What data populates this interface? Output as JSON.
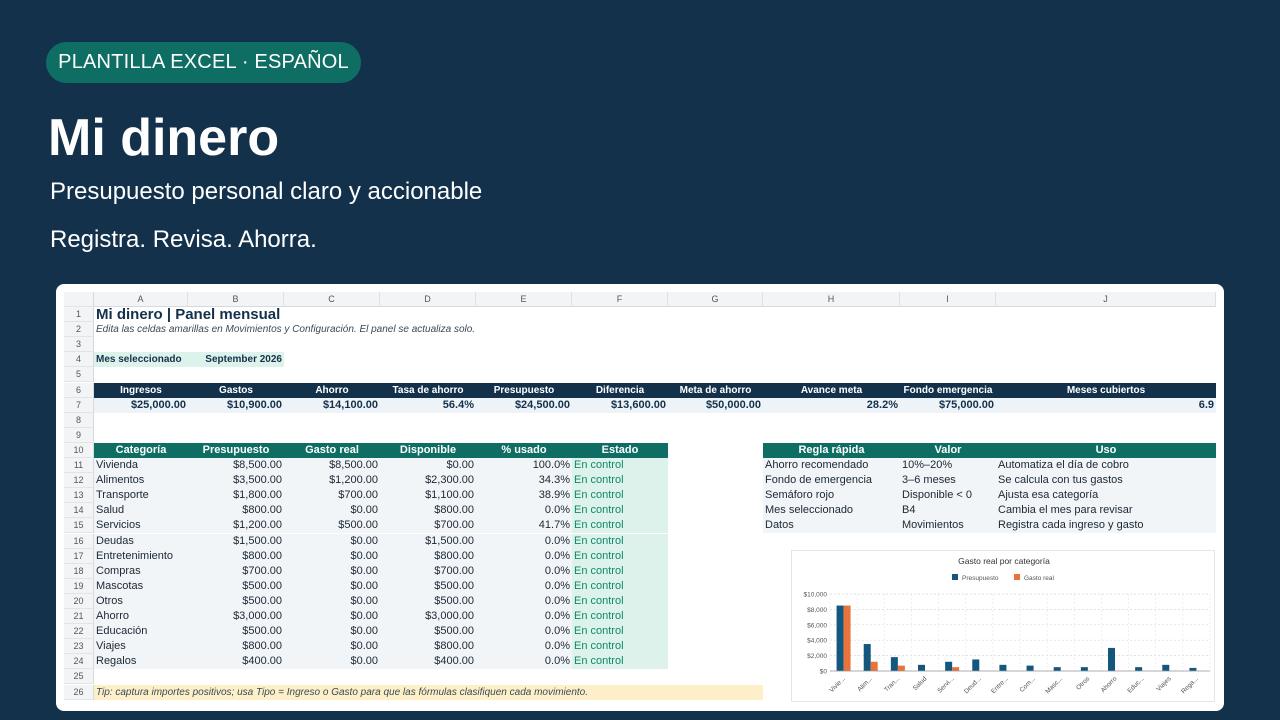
{
  "badge": "PLANTILLA EXCEL · ESPAÑOL",
  "title": "Mi dinero",
  "subtitle": "Presupuesto personal claro y accionable",
  "tagline": "Registra. Revisa. Ahorra.",
  "sheet": {
    "columns": [
      "A",
      "B",
      "C",
      "D",
      "E",
      "F",
      "G",
      "H",
      "I",
      "J"
    ],
    "rows": [
      "1",
      "2",
      "3",
      "4",
      "5",
      "6",
      "7",
      "8",
      "9",
      "10",
      "11",
      "12",
      "13",
      "14",
      "15",
      "16",
      "17",
      "18",
      "19",
      "20",
      "21",
      "22",
      "23",
      "24",
      "25",
      "26"
    ],
    "panel_title": "Mi dinero | Panel mensual",
    "panel_note": "Edita las celdas amarillas en Movimientos y Configuración. El panel se actualiza solo.",
    "month_label": "Mes seleccionado",
    "month_value": "September 2026",
    "kpi_headers": [
      "Ingresos",
      "Gastos",
      "Ahorro",
      "Tasa de ahorro",
      "Presupuesto",
      "Diferencia",
      "Meta de ahorro",
      "Avance meta",
      "Fondo emergencia",
      "Meses cubiertos"
    ],
    "kpi_values": [
      "$25,000.00",
      "$10,900.00",
      "$14,100.00",
      "56.4%",
      "$24,500.00",
      "$13,600.00",
      "$50,000.00",
      "28.2%",
      "$75,000.00",
      "6.9"
    ],
    "table_headers": [
      "Categoría",
      "Presupuesto",
      "Gasto real",
      "Disponible",
      "% usado",
      "Estado"
    ],
    "table_rows": [
      [
        "Vivienda",
        "$8,500.00",
        "$8,500.00",
        "$0.00",
        "100.0%",
        "En control"
      ],
      [
        "Alimentos",
        "$3,500.00",
        "$1,200.00",
        "$2,300.00",
        "34.3%",
        "En control"
      ],
      [
        "Transporte",
        "$1,800.00",
        "$700.00",
        "$1,100.00",
        "38.9%",
        "En control"
      ],
      [
        "Salud",
        "$800.00",
        "$0.00",
        "$800.00",
        "0.0%",
        "En control"
      ],
      [
        "Servicios",
        "$1,200.00",
        "$500.00",
        "$700.00",
        "41.7%",
        "En control"
      ],
      [
        "Deudas",
        "$1,500.00",
        "$0.00",
        "$1,500.00",
        "0.0%",
        "En control"
      ],
      [
        "Entretenimiento",
        "$800.00",
        "$0.00",
        "$800.00",
        "0.0%",
        "En control"
      ],
      [
        "Compras",
        "$700.00",
        "$0.00",
        "$700.00",
        "0.0%",
        "En control"
      ],
      [
        "Mascotas",
        "$500.00",
        "$0.00",
        "$500.00",
        "0.0%",
        "En control"
      ],
      [
        "Otros",
        "$500.00",
        "$0.00",
        "$500.00",
        "0.0%",
        "En control"
      ],
      [
        "Ahorro",
        "$3,000.00",
        "$0.00",
        "$3,000.00",
        "0.0%",
        "En control"
      ],
      [
        "Educación",
        "$500.00",
        "$0.00",
        "$500.00",
        "0.0%",
        "En control"
      ],
      [
        "Viajes",
        "$800.00",
        "$0.00",
        "$800.00",
        "0.0%",
        "En control"
      ],
      [
        "Regalos",
        "$400.00",
        "$0.00",
        "$400.00",
        "0.0%",
        "En control"
      ]
    ],
    "rules_headers": [
      "Regla rápida",
      "Valor",
      "Uso"
    ],
    "rules_rows": [
      [
        "Ahorro recomendado",
        "10%–20%",
        "Automatiza el día de cobro"
      ],
      [
        "Fondo de emergencia",
        "3–6 meses",
        "Se calcula con tus gastos"
      ],
      [
        "Semáforo rojo",
        "Disponible < 0",
        "Ajusta esa categoría"
      ],
      [
        "Mes seleccionado",
        "B4",
        "Cambia el mes para revisar"
      ],
      [
        "Datos",
        "Movimientos",
        "Registra cada ingreso y gasto"
      ]
    ],
    "tip": "Tip: captura importes positivos; usa Tipo = Ingreso o Gasto para que las fórmulas clasifiquen cada movimiento."
  },
  "chart_data": {
    "type": "bar",
    "title": "Gasto real por categoría",
    "categories": [
      "Vivie...",
      "Alim...",
      "Tran...",
      "Salud",
      "Servi...",
      "Deud...",
      "Entre...",
      "Com...",
      "Masc...",
      "Otros",
      "Ahorro",
      "Educ...",
      "Viajes",
      "Rega..."
    ],
    "series": [
      {
        "name": "Presupuesto",
        "values": [
          8500,
          3500,
          1800,
          800,
          1200,
          1500,
          800,
          700,
          500,
          500,
          3000,
          500,
          800,
          400
        ]
      },
      {
        "name": "Gasto real",
        "values": [
          8500,
          1200,
          700,
          0,
          500,
          0,
          0,
          0,
          0,
          0,
          0,
          0,
          0,
          0
        ]
      }
    ],
    "ylim": [
      0,
      10000
    ],
    "yticks": [
      "$10,000",
      "$8,000",
      "$6,000",
      "$4,000",
      "$2,000",
      "$0"
    ],
    "colors": {
      "Presupuesto": "#14577e",
      "Gasto real": "#e8743b"
    },
    "legend": "top-center",
    "grid": true
  }
}
